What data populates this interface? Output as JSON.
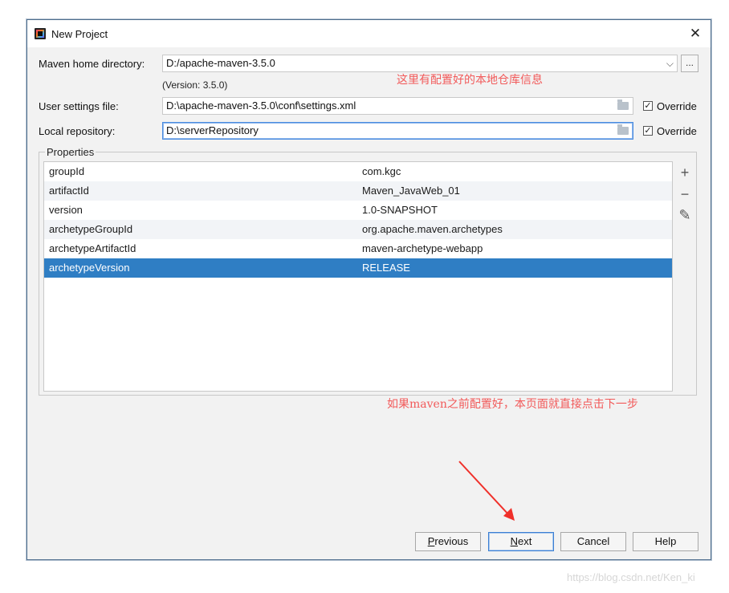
{
  "window": {
    "title": "New Project",
    "app_icon": "intellij-idea-icon",
    "close_icon": "close-icon"
  },
  "maven_home": {
    "label": "Maven home directory:",
    "value": "D:/apache-maven-3.5.0",
    "version_note": "(Version: 3.5.0)",
    "browse_label": "..."
  },
  "user_settings": {
    "label": "User settings file:",
    "value": "D:\\apache-maven-3.5.0\\conf\\settings.xml",
    "override_label": "Override",
    "override_checked": true
  },
  "local_repo": {
    "label": "Local repository:",
    "value": "D:\\serverRepository",
    "override_label": "Override",
    "override_checked": true
  },
  "properties": {
    "legend": "Properties",
    "rows": [
      {
        "key": "groupId",
        "value": "com.kgc"
      },
      {
        "key": "artifactId",
        "value": "Maven_JavaWeb_01"
      },
      {
        "key": "version",
        "value": "1.0-SNAPSHOT"
      },
      {
        "key": "archetypeGroupId",
        "value": "org.apache.maven.archetypes"
      },
      {
        "key": "archetypeArtifactId",
        "value": "maven-archetype-webapp"
      },
      {
        "key": "archetypeVersion",
        "value": "RELEASE"
      }
    ],
    "selected_index": 5,
    "tools": {
      "add": "+",
      "remove": "−",
      "edit": "✎"
    }
  },
  "annotations": {
    "top": "这里有配置好的本地仓库信息",
    "bottom": "如果maven之前配置好，本页面就直接点击下一步",
    "color": "#f25a5a"
  },
  "buttons": {
    "previous": {
      "prefix": "",
      "mnemonic": "P",
      "rest": "revious"
    },
    "next": {
      "prefix": "",
      "mnemonic": "N",
      "rest": "ext"
    },
    "cancel": "Cancel",
    "help": "Help"
  },
  "watermark": "https://blog.csdn.net/Ken_ki"
}
